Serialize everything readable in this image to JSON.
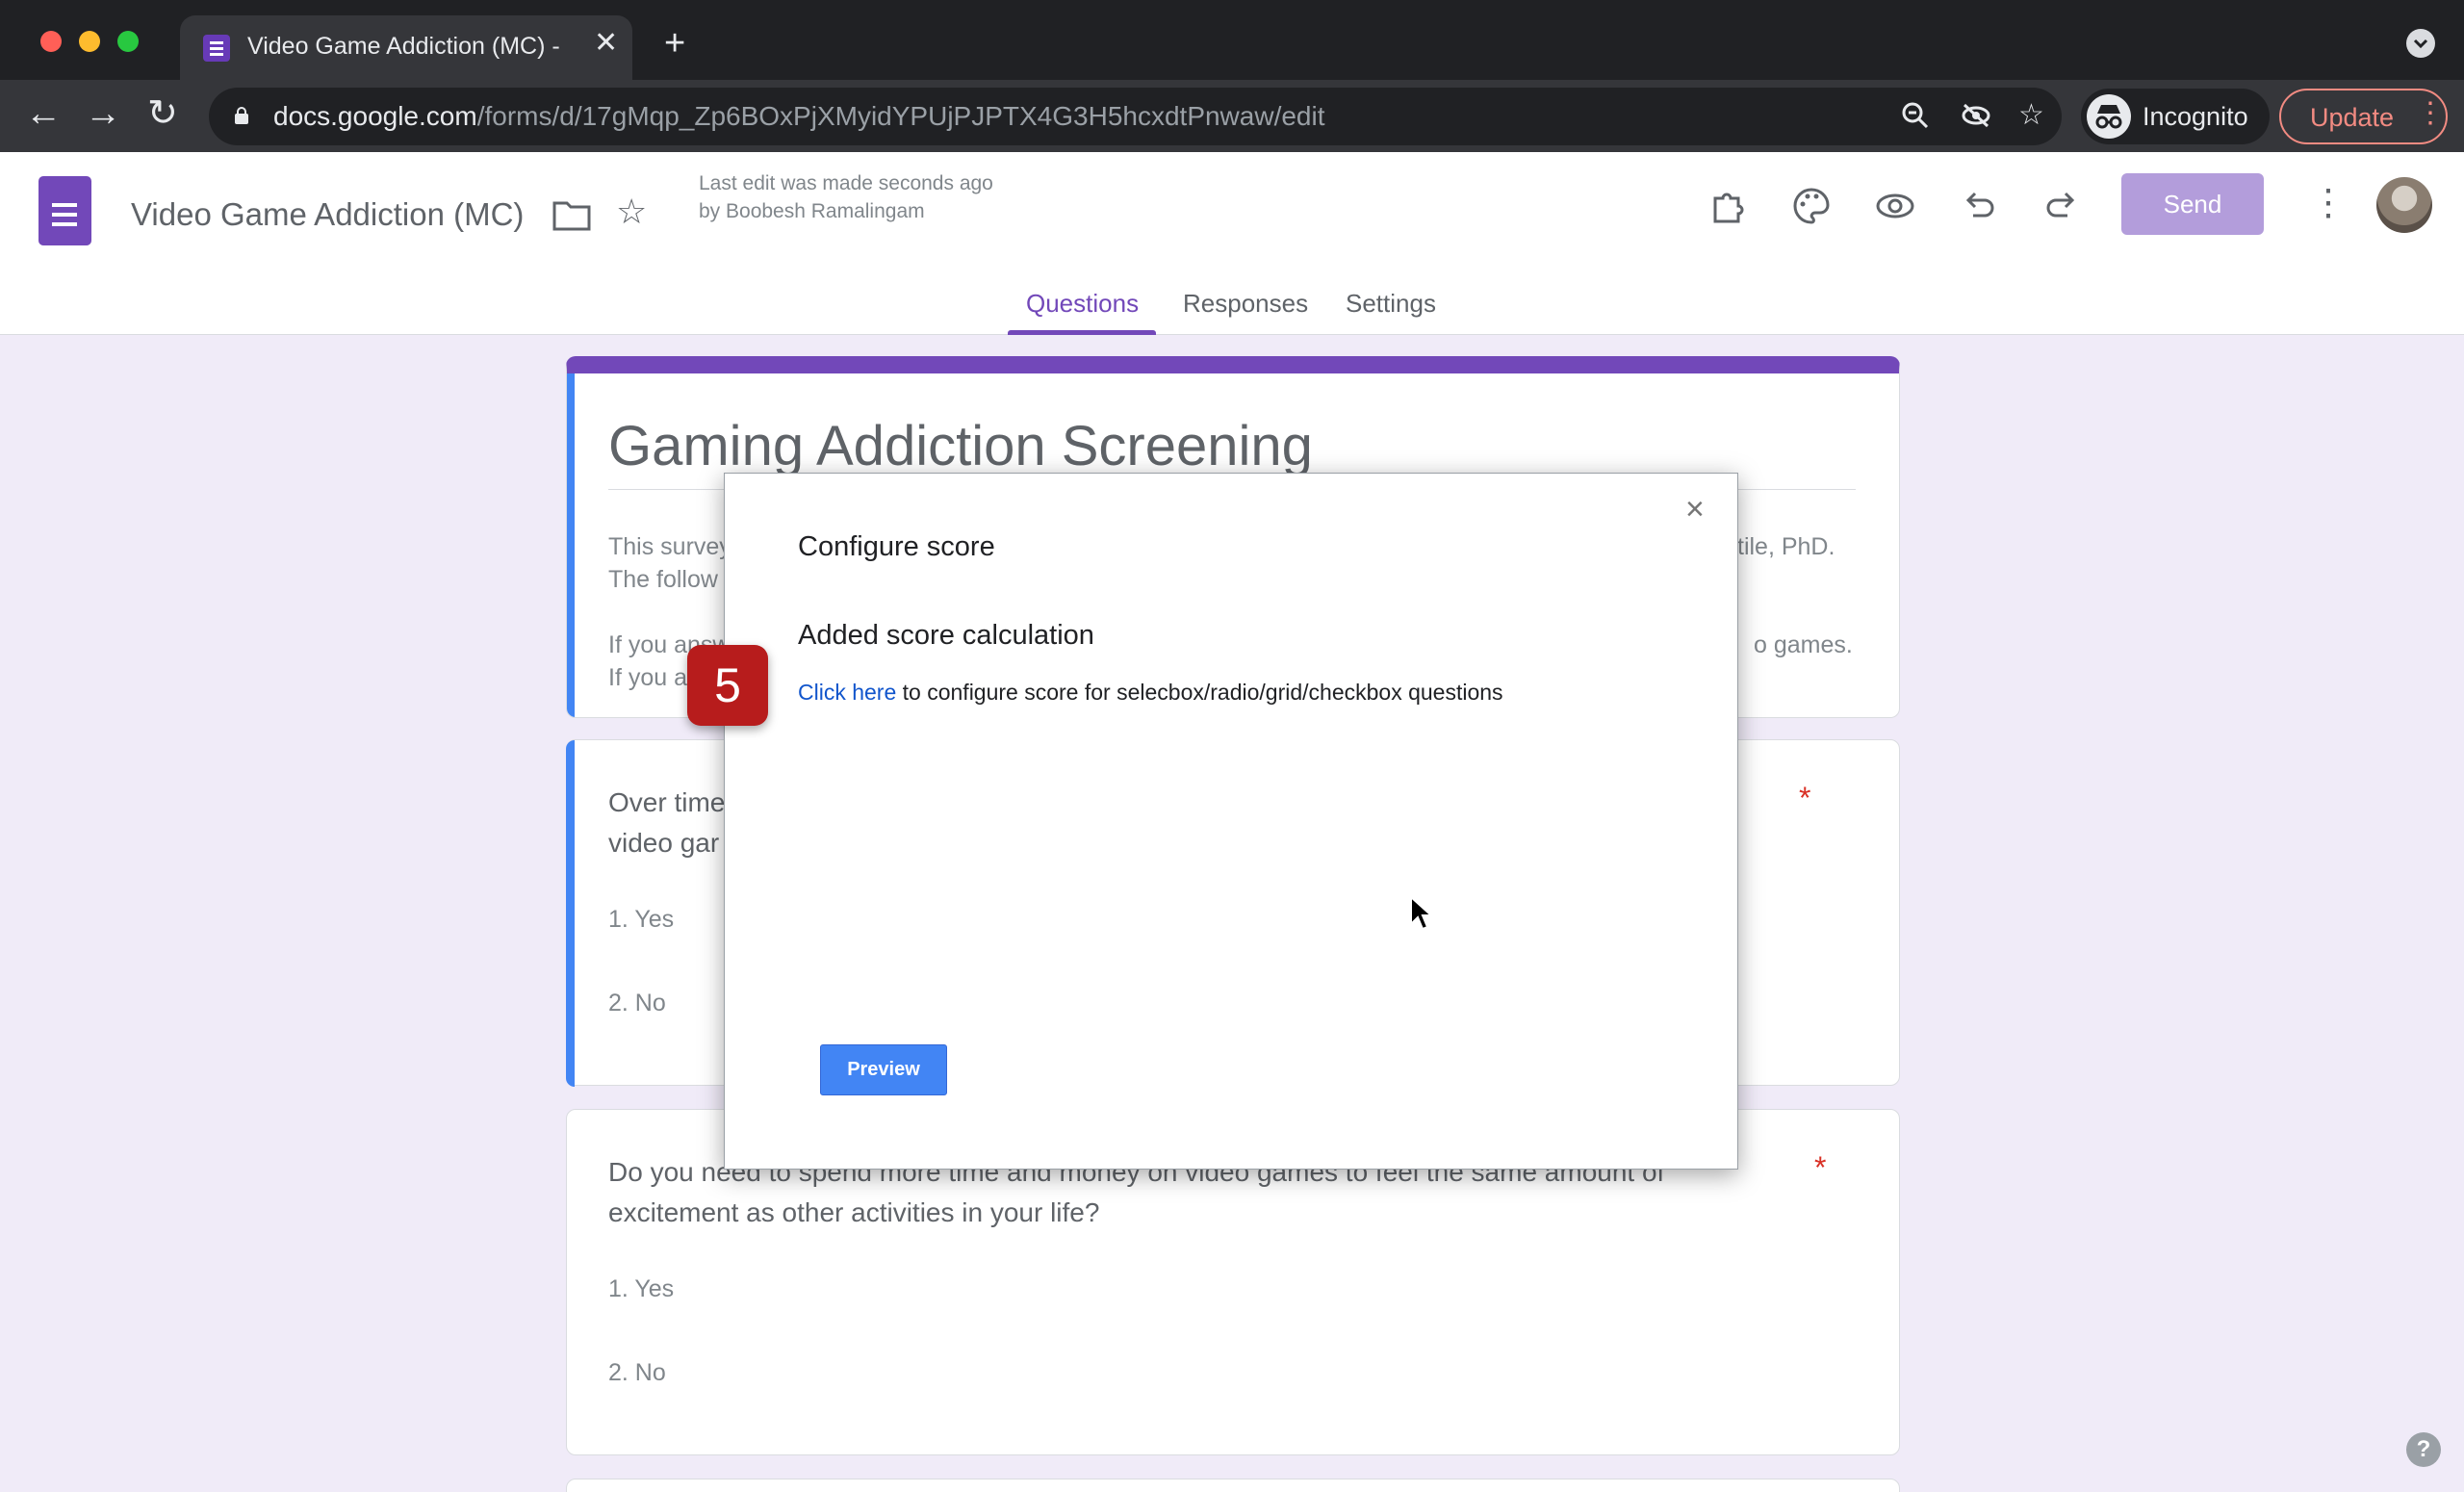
{
  "browser": {
    "tab_title": "Video Game Addiction (MC) - Google Forms",
    "tab_close": "✕",
    "new_tab": "+",
    "url_host": "docs.google.com",
    "url_path": "/forms/d/17gMqp_Zp6BOxPjXMyidYPUjPJPTX4G3H5hcxdtPnwaw/edit",
    "incognito_label": "Incognito",
    "update_label": "Update",
    "icons": [
      "back-icon",
      "forward-icon",
      "reload-icon",
      "zoom-icon",
      "eye-off-icon",
      "star-icon"
    ]
  },
  "app": {
    "doc_title": "Video Game Addiction (MC)",
    "last_edit": "Last edit was made seconds ago by Boobesh Ramalingam",
    "send_label": "Send",
    "tabs": [
      {
        "label": "Questions",
        "active": true
      },
      {
        "label": "Responses",
        "active": false
      },
      {
        "label": "Settings",
        "active": false
      }
    ]
  },
  "form": {
    "title": "Gaming Addiction Screening",
    "desc_line1_left": "This survey",
    "desc_line1_right": "tile, PhD.",
    "desc_line2_left": "The follow",
    "desc_line3_left": "If you answ",
    "desc_line3_right": "o games.",
    "desc_line4_left": "If you a",
    "questions": [
      {
        "text_line1": "Over time",
        "text_line2": "video gar",
        "required": "*",
        "options": [
          "1.   Yes",
          "2.   No"
        ]
      },
      {
        "text_line1": "Do you need to spend more time and money on video games to feel the same amount of",
        "text_line2": "excitement as other activities in your life?",
        "required": "*",
        "options": [
          "1.   Yes",
          "2.   No"
        ]
      }
    ]
  },
  "modal": {
    "title": "Configure score",
    "close": "×",
    "subtitle": "Added score calculation",
    "link_text": "Click here",
    "line_rest": " to configure score for selecbox/radio/grid/checkbox questions",
    "preview_label": "Preview"
  },
  "overlay": {
    "step_number": "5",
    "help": "?"
  }
}
